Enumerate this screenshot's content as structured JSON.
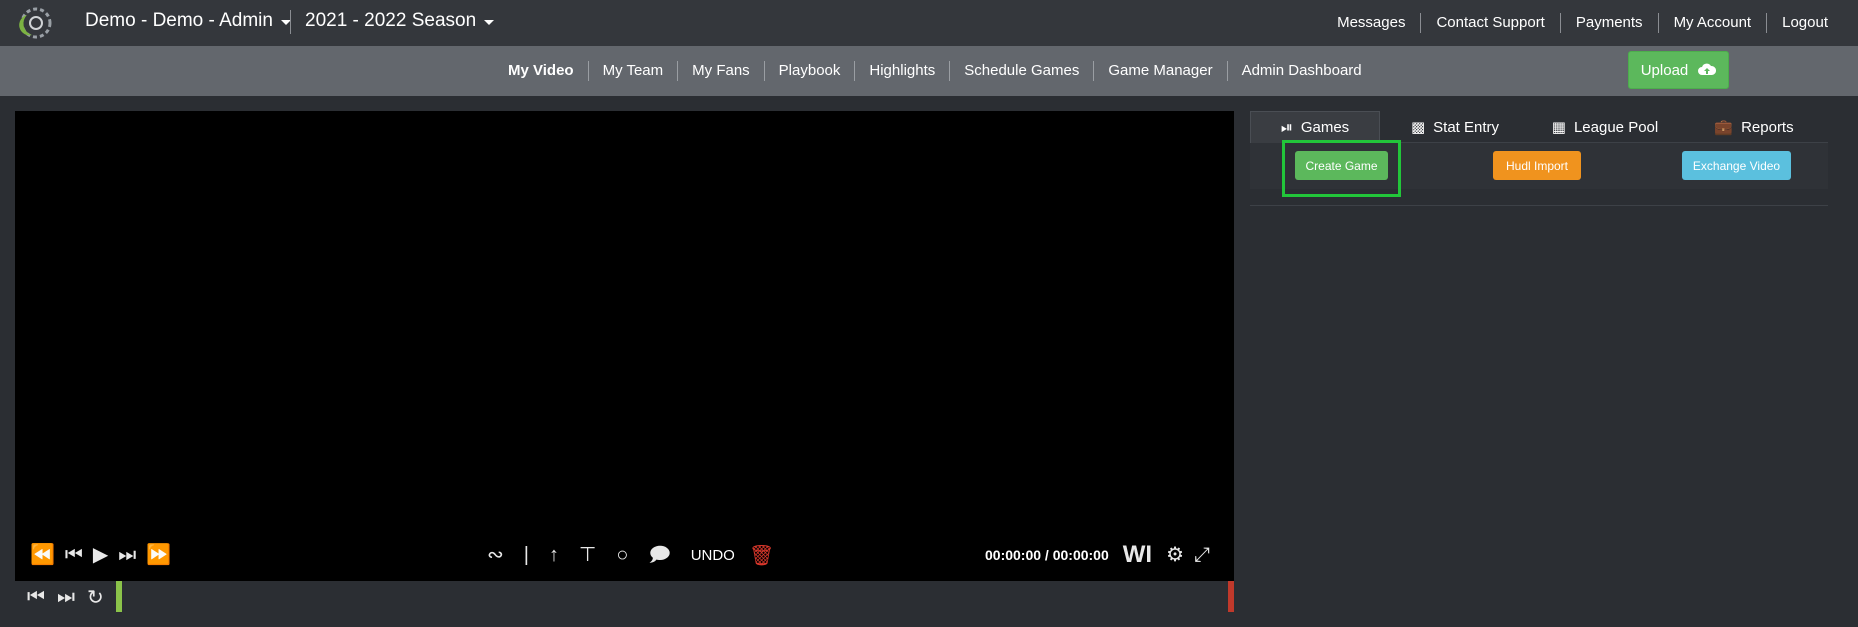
{
  "header": {
    "team": "Demo - Demo - Admin",
    "season": "2021 - 2022 Season",
    "links": [
      "Messages",
      "Contact Support",
      "Payments",
      "My Account",
      "Logout"
    ]
  },
  "nav": {
    "items": [
      "My Video",
      "My Team",
      "My Fans",
      "Playbook",
      "Highlights",
      "Schedule Games",
      "Game Manager",
      "Admin Dashboard"
    ],
    "upload_label": "Upload"
  },
  "player": {
    "undo_label": "UNDO",
    "timecode": "00:00:00 / 00:00:00",
    "wi_label": "WI"
  },
  "panel": {
    "tabs": [
      {
        "label": "Games",
        "icon": "play-circle-icon"
      },
      {
        "label": "Stat Entry",
        "icon": "bar-chart-icon"
      },
      {
        "label": "League Pool",
        "icon": "table-icon"
      },
      {
        "label": "Reports",
        "icon": "briefcase-icon"
      }
    ],
    "buttons": {
      "create_game": "Create Game",
      "hudl_import": "Hudl Import",
      "exchange_video": "Exchange Video"
    }
  },
  "colors": {
    "accent_green": "#5cb85c",
    "orange": "#f0931e",
    "light_blue": "#5bc0de",
    "delete_red": "#d9372b",
    "highlight_green": "#22c63a"
  }
}
